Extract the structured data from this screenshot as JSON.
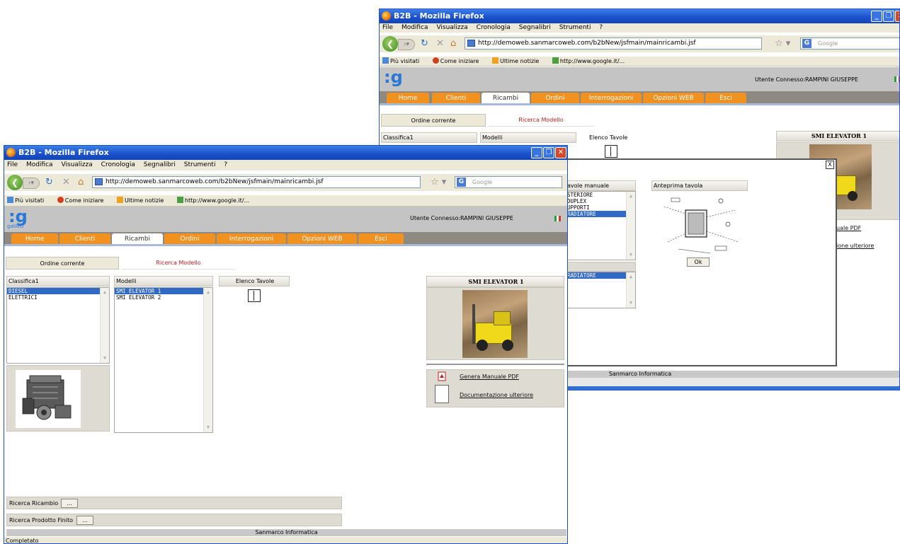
{
  "back_window": {
    "title": "B2B - Mozilla Firefox",
    "menu": [
      "File",
      "Modifica",
      "Visualizza",
      "Cronologia",
      "Segnalibri",
      "Strumenti",
      "?"
    ],
    "url": "http://demoweb.sanmarcoweb.com/b2bNew/jsfmain/mainricambi.jsf",
    "search_placeholder": "Google",
    "bookmarks": [
      "Più visitati",
      "Come iniziare",
      "Ultime notizie",
      "http://www.google.it/..."
    ],
    "user": "Utente Connesso:RAMPINI GIUSEPPE",
    "tabs": [
      "Home",
      "Clienti",
      "Ricambi",
      "Ordini",
      "Interrogazioni",
      "Opzioni WEB",
      "Esci"
    ],
    "subtabs": [
      "Ordine corrente",
      "Ricerca Modello"
    ],
    "panels": {
      "classifica": "Classifica1",
      "modelli": "Modelli",
      "elenco": "Elenco Tavole",
      "model_title": "SMI ELEVATOR 1"
    },
    "links": [
      "uale PDF",
      "ione ulteriore"
    ],
    "footer": "Sanmarco Informatica",
    "dialog": {
      "close": "X",
      "tavole_label": "avole manuale",
      "tavole_items": [
        "STERIORE",
        " DUPLEX",
        "UPPORTI",
        "RADIATORE"
      ],
      "selected_item": "RADIATORE",
      "preview_label": "Anteprima tavola",
      "ok": "Ok"
    }
  },
  "front_window": {
    "title": "B2B - Mozilla Firefox",
    "menu": [
      "File",
      "Modifica",
      "Visualizza",
      "Cronologia",
      "Segnalibri",
      "Strumenti",
      "?"
    ],
    "url": "http://demoweb.sanmarcoweb.com/b2bNew/jsfmain/mainricambi.jsf",
    "search_placeholder": "Google",
    "bookmarks": [
      "Più visitati",
      "Come iniziare",
      "Ultime notizie",
      "http://www.google.it/..."
    ],
    "logo": "galileo",
    "user": "Utente Connesso:RAMPINI GIUSEPPE",
    "tabs": [
      "Home",
      "Clienti",
      "Ricambi",
      "Ordini",
      "Interrogazioni",
      "Opzioni WEB",
      "Esci"
    ],
    "active_tab": "Ricambi",
    "subtabs": [
      "Ordine corrente",
      "Ricerca Modello"
    ],
    "classifica": {
      "label": "Classifica1",
      "items": [
        "DIESEL",
        "ELETTRICI"
      ],
      "selected": "DIESEL"
    },
    "modelli": {
      "label": "Modelli",
      "items": [
        "SMI ELEVATOR 1",
        "SMI ELEVATOR 2"
      ],
      "selected": "SMI ELEVATOR 1"
    },
    "elenco_label": "Elenco Tavole",
    "model_title": "SMI ELEVATOR 1",
    "links": {
      "pdf": "Genera Manuale PDF",
      "doc": "Documentazione ulteriore"
    },
    "ricerca_ricambio": "Ricerca Ricambio",
    "ricerca_prodotto": "Ricerca Prodotto Finito",
    "ellipsis": "...",
    "footer": "Sanmarco Informatica",
    "status": "Completato"
  },
  "colors": {
    "titlebar": "#1a4fc9",
    "tab_orange": "#f19120",
    "selection": "#316ac5",
    "header_gray": "#c4c4c4",
    "logo_blue": "#2878d8"
  }
}
